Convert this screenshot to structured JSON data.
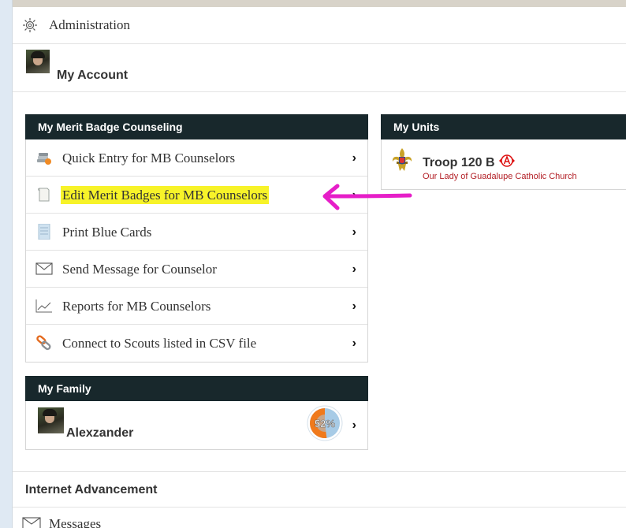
{
  "admin": {
    "label": "Administration"
  },
  "account": {
    "label": "My Account"
  },
  "merit_badge": {
    "header": "My Merit Badge Counseling",
    "items": [
      {
        "label": "Quick Entry for MB Counselors",
        "icon": "books-icon"
      },
      {
        "label": "Edit Merit Badges for MB Counselors",
        "icon": "document-icon",
        "highlighted": true
      },
      {
        "label": "Print Blue Cards",
        "icon": "blue-card-icon"
      },
      {
        "label": "Send Message for Counselor",
        "icon": "envelope-icon"
      },
      {
        "label": "Reports for MB Counselors",
        "icon": "line-chart-icon"
      },
      {
        "label": "Connect to Scouts listed in CSV file",
        "icon": "chain-link-icon"
      }
    ],
    "chevron": "›"
  },
  "units": {
    "header": "My Units",
    "troop_name": "Troop 120 B",
    "troop_org": "Our Lady of Guadalupe Catholic Church"
  },
  "family": {
    "header": "My Family",
    "member_name": "Alexzander",
    "progress_label": "52%",
    "progress_value": 0.52
  },
  "internet_advancement": {
    "label": "Internet Advancement"
  },
  "messages": {
    "label": "Messages"
  },
  "colors": {
    "panel_header": "#18282c",
    "highlight": "#f7f329",
    "annotation_arrow": "#e61ec8",
    "troop_sub": "#b21d24"
  }
}
